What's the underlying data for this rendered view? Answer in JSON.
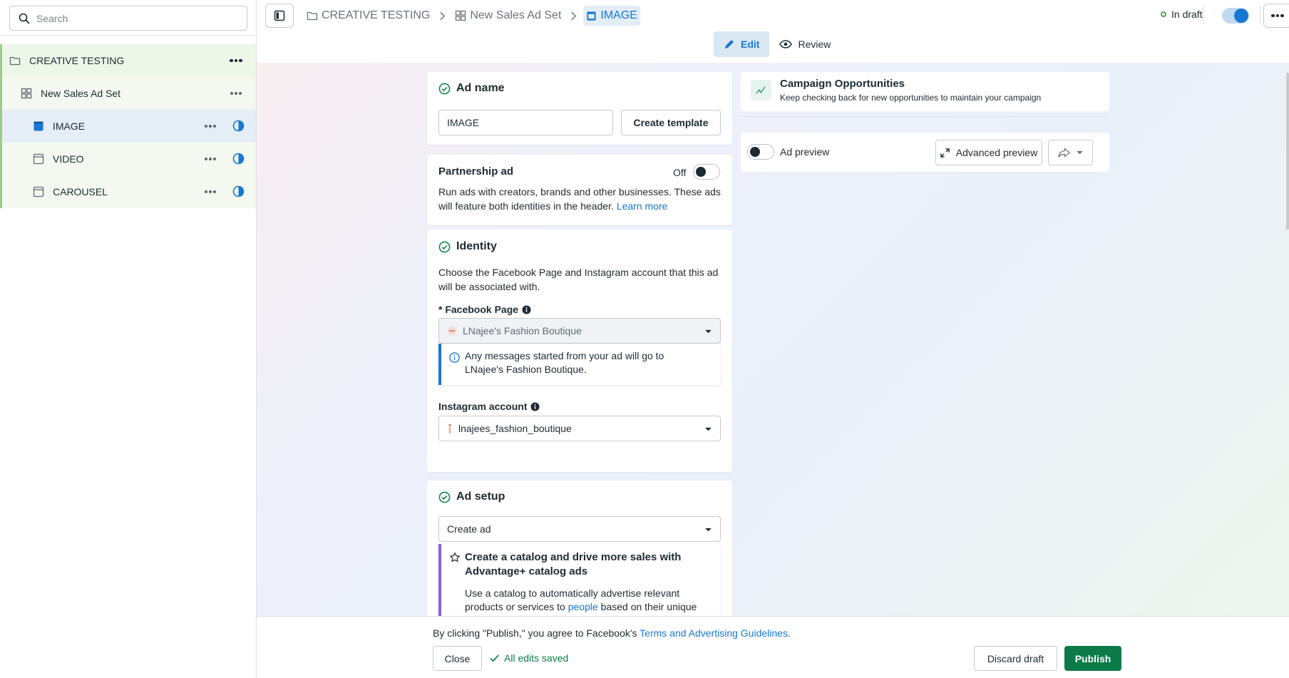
{
  "sidebar": {
    "search_placeholder": "Search",
    "items": [
      {
        "label": "CREATIVE TESTING",
        "icon": "folder-icon"
      },
      {
        "label": "New Sales Ad Set",
        "icon": "grid-icon"
      },
      {
        "label": "IMAGE",
        "icon": "image-ad-icon"
      },
      {
        "label": "VIDEO",
        "icon": "ad-icon"
      },
      {
        "label": "CAROUSEL",
        "icon": "ad-icon"
      }
    ]
  },
  "breadcrumb": {
    "campaign": "CREATIVE TESTING",
    "adset": "New Sales Ad Set",
    "ad": "IMAGE"
  },
  "status": {
    "draft_label": "In draft"
  },
  "mode_tabs": {
    "edit": "Edit",
    "review": "Review"
  },
  "ad_name": {
    "title": "Ad name",
    "value": "IMAGE",
    "create_template": "Create template"
  },
  "partnership": {
    "title": "Partnership ad",
    "toggle_label": "Off",
    "description": "Run ads with creators, brands and other businesses. These ads will feature both identities in the header.",
    "learn_more": "Learn more"
  },
  "identity": {
    "title": "Identity",
    "description": "Choose the Facebook Page and Instagram account that this ad will be associated with.",
    "facebook_page_label": "* Facebook Page",
    "facebook_page_value": "LNajee's Fashion Boutique",
    "info_message": "Any messages started from your ad will go to LNajee's Fashion Boutique.",
    "instagram_label": "Instagram account",
    "instagram_value": "lnajees_fashion_boutique"
  },
  "ad_setup": {
    "title": "Ad setup",
    "select_value": "Create ad",
    "promo_title": "Create a catalog and drive more sales with Advantage+ catalog ads",
    "promo_text_1": "Use a catalog to automatically advertise relevant",
    "promo_text_2a": "products or services to ",
    "promo_text_link": "people",
    "promo_text_2b": " based on their unique"
  },
  "opportunities": {
    "title": "Campaign Opportunities",
    "subtitle": "Keep checking back for new opportunities to maintain your campaign"
  },
  "preview": {
    "toggle_label": "Ad preview",
    "advanced": "Advanced preview"
  },
  "footer": {
    "consent_prefix": "By clicking \"Publish,\" you agree to Facebook's ",
    "consent_link": "Terms and Advertising Guidelines",
    "consent_suffix": ".",
    "close": "Close",
    "saved": "All edits saved",
    "discard": "Discard draft",
    "publish": "Publish"
  },
  "colors": {
    "accent": "#1877d2",
    "publish_green": "#0a7a49",
    "tree_green": "#9ccb8a",
    "draft_dot": "#49a54a",
    "promo_purple": "#8c62d1"
  }
}
